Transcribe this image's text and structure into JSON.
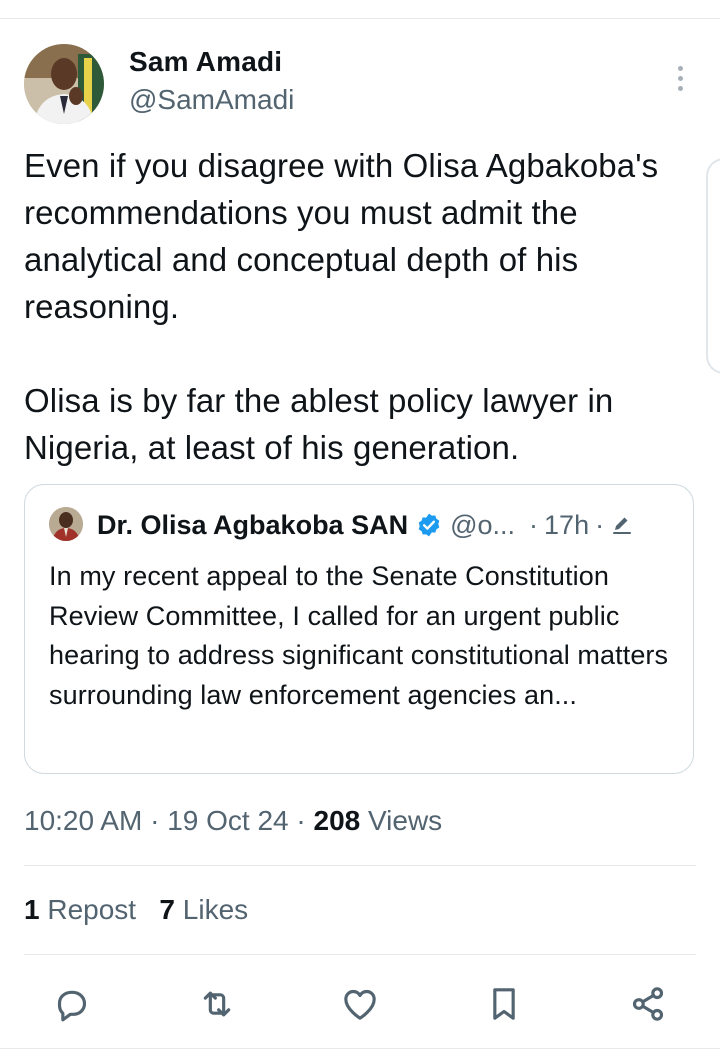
{
  "author": {
    "name": "Sam Amadi",
    "handle": "@SamAmadi"
  },
  "tweet": {
    "text": "Even if you disagree with Olisa Agbakoba's recommendations you must admit the analytical and conceptual depth of his reasoning.\n\nOlisa is by far the ablest policy lawyer in Nigeria, at least of his generation."
  },
  "quote": {
    "name": "Dr. Olisa Agbakoba SAN",
    "handle": "@o...",
    "separator": "·",
    "time": "17h",
    "separator2": "·",
    "text": "In my recent appeal to the Senate Constitution Review Committee, I called for an urgent public hearing to address significant constitutional matters surrounding law enforcement agencies an...",
    "verified_color": "#1d9bf0",
    "icons": [
      "verified-badge-icon",
      "edit-icon"
    ]
  },
  "meta": {
    "time": "10:20 AM",
    "sep1": " · ",
    "date": "19 Oct 24",
    "sep2": " · ",
    "views_count": "208",
    "views_label": " Views"
  },
  "stats": {
    "reposts_count": "1",
    "reposts_label": "Repost",
    "likes_count": "7",
    "likes_label": "Likes"
  },
  "actions": [
    "reply-icon",
    "repost-icon",
    "like-icon",
    "bookmark-icon",
    "share-icon"
  ],
  "colors": {
    "text": "#0f1419",
    "secondary": "#536471",
    "border": "#cfd9de",
    "icon": "#536471"
  }
}
